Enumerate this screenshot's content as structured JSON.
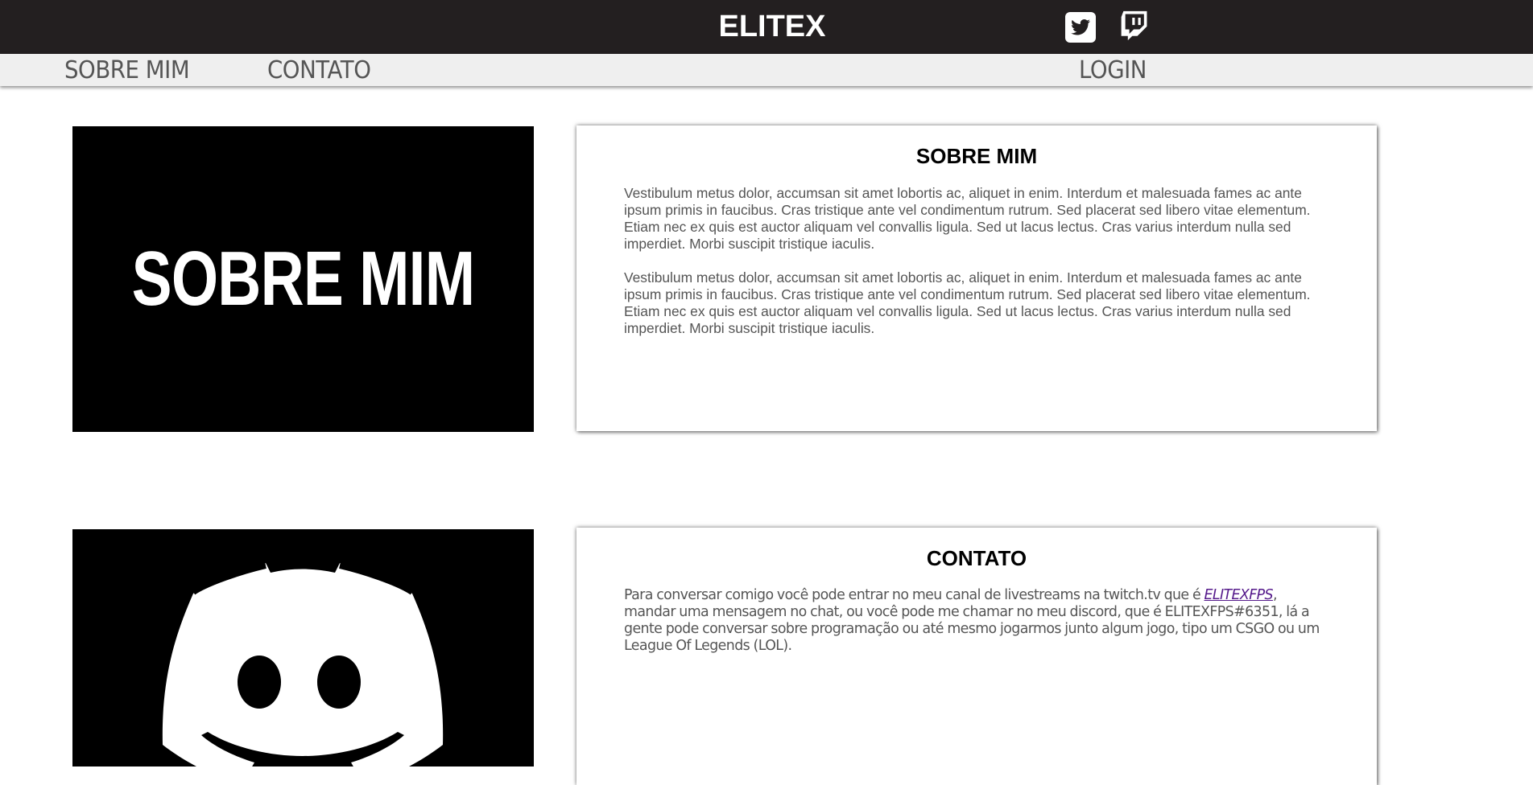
{
  "header": {
    "title": "ELITEX",
    "background_color": "#231f20",
    "social": [
      {
        "name": "twitter",
        "icon": "twitter-icon"
      },
      {
        "name": "twitch",
        "icon": "twitch-icon"
      }
    ]
  },
  "nav": {
    "sobre_label": "SOBRE MIM",
    "contato_label": "CONTATO",
    "login_label": "LOGIN"
  },
  "sobre": {
    "image_text": "SOBRE MIM",
    "title": "SOBRE MIM",
    "paragraphs": [
      "Vestibulum metus dolor, accumsan sit amet lobortis ac, aliquet in enim. Interdum et malesuada fames ac ante ipsum primis in faucibus. Cras tristique ante vel condimentum rutrum. Sed placerat sed libero vitae elementum. Etiam nec ex quis est auctor aliquam vel convallis ligula. Sed ut lacus lectus. Cras varius interdum nulla sed imperdiet. Morbi suscipit tristique iaculis.",
      "Vestibulum metus dolor, accumsan sit amet lobortis ac, aliquet in enim. Interdum et malesuada fames ac ante ipsum primis in faucibus. Cras tristique ante vel condimentum rutrum. Sed placerat sed libero vitae elementum. Etiam nec ex quis est auctor aliquam vel convallis ligula. Sed ut lacus lectus. Cras varius interdum nulla sed imperdiet. Morbi suscipit tristique iaculis."
    ]
  },
  "contato": {
    "image_icon": "discord-logo-icon",
    "title": "CONTATO",
    "text_before": "Para conversar comigo você pode entrar no meu canal de livestreams na twitch.tv que é ",
    "link_text": "ELITEXFPS",
    "text_after": ", mandar uma mensagem no chat, ou você pode me chamar no meu discord, que é ELITEXFPS#6351, lá a gente pode conversar sobre programação ou até mesmo jogarmos junto algum jogo, tipo um CSGO ou um League Of Legends (LOL)."
  }
}
